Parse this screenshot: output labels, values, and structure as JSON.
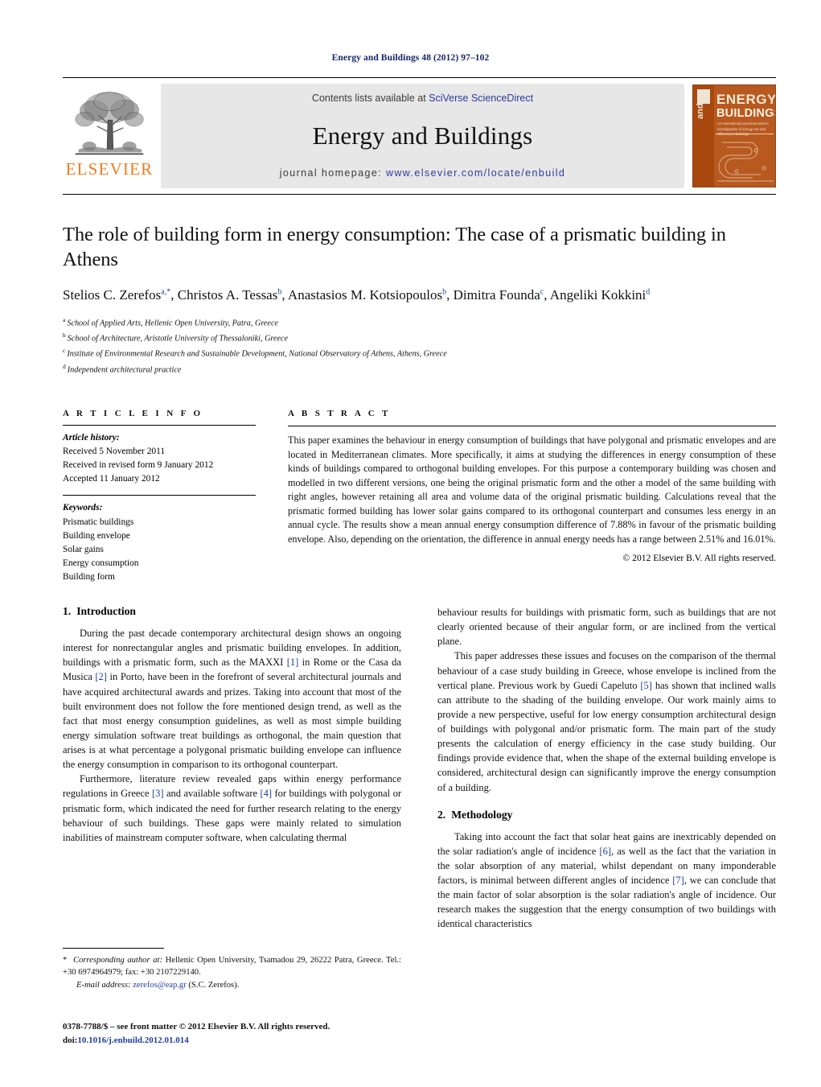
{
  "running_head": "Energy and Buildings 48 (2012) 97–102",
  "masthead": {
    "publisher_wordmark": "ELSEVIER",
    "contents_prefix": "Contents lists available at",
    "contents_link": "SciVerse ScienceDirect",
    "journal_title": "Energy and Buildings",
    "homepage_prefix": "journal homepage:",
    "homepage_link": "www.elsevier.com/locate/enbuild",
    "cover": {
      "word_and": "and",
      "word_energy": "ENERGY",
      "word_buildings": "BUILDINGS",
      "subtitle": "An international journal devoted to investigations of energy use and efficiency in buildings"
    }
  },
  "article": {
    "title": "The role of building form in energy consumption: The case of a prismatic building in Athens",
    "authors_html": "Stelios C. Zerefos<sup>a,*</sup>, Christos A. Tessas<sup>b</sup>, Anastasios M. Kotsiopoulos<sup>b</sup>, Dimitra Founda<sup>c</sup>, Angeliki Kokkini<sup>d</sup>",
    "affiliations": [
      {
        "marker": "a",
        "text": "School of Applied Arts, Hellenic Open University, Patra, Greece"
      },
      {
        "marker": "b",
        "text": "School of Architecture, Aristotle University of Thessaloniki, Greece"
      },
      {
        "marker": "c",
        "text": "Institute of Environmental Research and Sustainable Development, National Observatory of Athens, Athens, Greece"
      },
      {
        "marker": "d",
        "text": "Independent architectural practice"
      }
    ]
  },
  "article_info": {
    "heading": "A R T I C L E   I N F O",
    "history_label": "Article history:",
    "history": [
      "Received 5 November 2011",
      "Received in revised form 9 January 2012",
      "Accepted 11 January 2012"
    ],
    "keywords_label": "Keywords:",
    "keywords": [
      "Prismatic buildings",
      "Building envelope",
      "Solar gains",
      "Energy consumption",
      "Building form"
    ]
  },
  "abstract": {
    "heading": "A B S T R A C T",
    "text": "This paper examines the behaviour in energy consumption of buildings that have polygonal and prismatic envelopes and are located in Mediterranean climates. More specifically, it aims at studying the differences in energy consumption of these kinds of buildings compared to orthogonal building envelopes. For this purpose a contemporary building was chosen and modelled in two different versions, one being the original prismatic form and the other a model of the same building with right angles, however retaining all area and volume data of the original prismatic building. Calculations reveal that the prismatic formed building has lower solar gains compared to its orthogonal counterpart and consumes less energy in an annual cycle. The results show a mean annual energy consumption difference of 7.88% in favour of the prismatic building envelope. Also, depending on the orientation, the difference in annual energy needs has a range between 2.51% and 16.01%.",
    "copyright": "© 2012 Elsevier B.V. All rights reserved."
  },
  "sections": {
    "intro_number": "1.",
    "intro_title": "Introduction",
    "intro_p1_html": "During the past decade contemporary architectural design shows an ongoing interest for nonrectangular angles and prismatic building envelopes. In addition, buildings with a prismatic form, such as the MAXXI <span class=\"ref\">[1]</span> in Rome or the Casa da Musica <span class=\"ref\">[2]</span> in Porto, have been in the forefront of several architectural journals and have acquired architectural awards and prizes. Taking into account that most of the built environment does not follow the fore mentioned design trend, as well as the fact that most energy consumption guidelines, as well as most simple building energy simulation software treat buildings as orthogonal, the main question that arises is at what percentage a polygonal prismatic building envelope can influence the energy consumption in comparison to its orthogonal counterpart.",
    "intro_p2_html": "Furthermore, literature review revealed gaps within energy performance regulations in Greece <span class=\"ref\">[3]</span> and available software <span class=\"ref\">[4]</span> for buildings with polygonal or prismatic form, which indicated the need for further research relating to the energy behaviour of such buildings. These gaps were mainly related to simulation inabilities of mainstream computer software, when calculating thermal behaviour results for buildings with prismatic form, such as buildings that are not clearly oriented because of their angular form, or are inclined from the vertical plane.",
    "intro_p3_html": "This paper addresses these issues and focuses on the comparison of the thermal behaviour of a case study building in Greece, whose envelope is inclined from the vertical plane. Previous work by Guedi Capeluto <span class=\"ref\">[5]</span> has shown that inclined walls can attribute to the shading of the building envelope. Our work mainly aims to provide a new perspective, useful for low energy consumption architectural design of buildings with polygonal and/or prismatic form. The main part of the study presents the calculation of energy efficiency in the case study building. Our findings provide evidence that, when the shape of the external building envelope is considered, architectural design can significantly improve the energy consumption of a building.",
    "method_number": "2.",
    "method_title": "Methodology",
    "method_p1_html": "Taking into account the fact that solar heat gains are inextricably depended on the solar radiation's angle of incidence <span class=\"ref\">[6]</span>, as well as the fact that the variation in the solar absorption of any material, whilst dependant on many imponderable factors, is minimal between different angles of incidence <span class=\"ref\">[7]</span>, we can conclude that the main factor of solar absorption is the solar radiation's angle of incidence. Our research makes the suggestion that the energy consumption of two buildings with identical characteristics"
  },
  "footnote": {
    "corresponding_html": "<span class=\"star\">*</span> <i>Corresponding author at:</i> Hellenic Open University, Tsamadou 29, 26222 Patra, Greece. Tel.: +30 6974964979; fax: +30 2107229140.",
    "email_html": "<i>E-mail address:</i> <span class=\"fn-link\">zerefos@eap.gr</span> (S.C. Zerefos)."
  },
  "imprint": {
    "line1": "0378-7788/$ – see front matter © 2012 Elsevier B.V. All rights reserved.",
    "doi_prefix": "doi:",
    "doi": "10.1016/j.enbuild.2012.01.014"
  },
  "colors": {
    "link_blue": "#2b3b9e",
    "ref_blue": "#1f3fa0",
    "elsevier_orange": "#f07c1e",
    "band_gray": "#e7e7e7",
    "cover_orange": "#b8591f"
  }
}
